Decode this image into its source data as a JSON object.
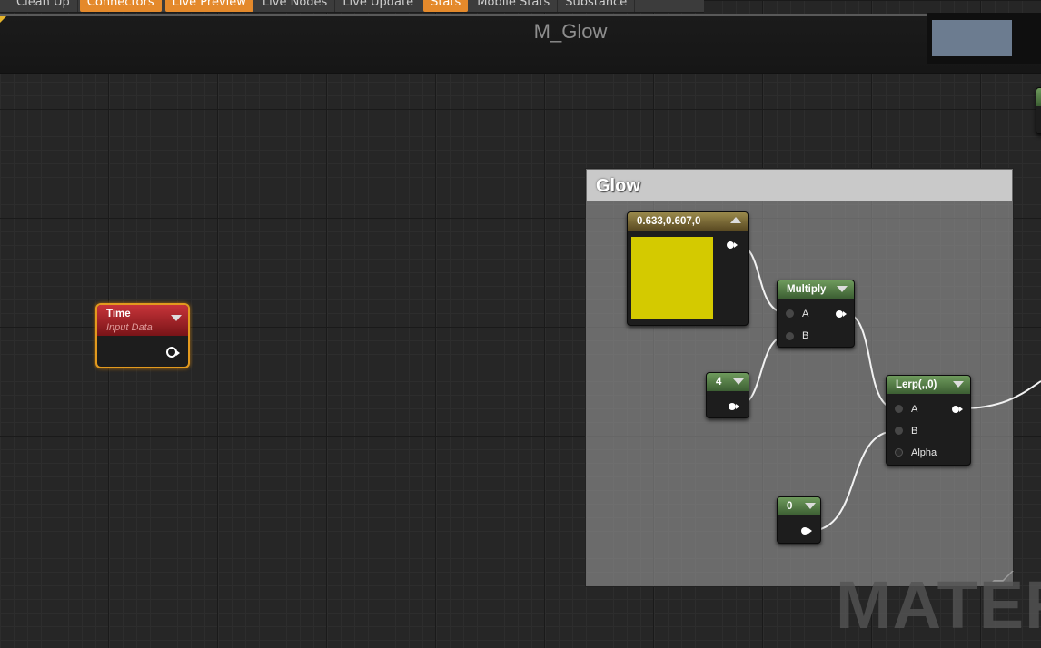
{
  "toolbar": {
    "items": [
      {
        "label": "Clean Up",
        "active": false
      },
      {
        "label": "Connectors",
        "active": true
      },
      {
        "label": "Live Preview",
        "active": true
      },
      {
        "label": "Live Nodes",
        "active": false
      },
      {
        "label": "Live Update",
        "active": false
      },
      {
        "label": "Stats",
        "active": true
      },
      {
        "label": "Mobile Stats",
        "active": false
      },
      {
        "label": "Substance",
        "active": false
      }
    ]
  },
  "graph": {
    "title": "M_Glow"
  },
  "comment": {
    "title": "Glow"
  },
  "nodes": {
    "time": {
      "title": "Time",
      "subtitle": "Input Data"
    },
    "color": {
      "title": "0.633,0.607,0",
      "swatch_color": "#d4ca00"
    },
    "multiply": {
      "title": "Multiply",
      "pin_a": "A",
      "pin_b": "B"
    },
    "const4": {
      "title": "4"
    },
    "lerp": {
      "title": "Lerp(,,0)",
      "pin_a": "A",
      "pin_b": "B",
      "pin_alpha": "Alpha"
    },
    "const0": {
      "title": "0"
    }
  },
  "watermark": "MATER",
  "colors": {
    "accent_orange": "#e4892b",
    "constant_header": "#6e9a5c",
    "time_header": "#c8343a",
    "vector_header": "#9a8a4c"
  }
}
